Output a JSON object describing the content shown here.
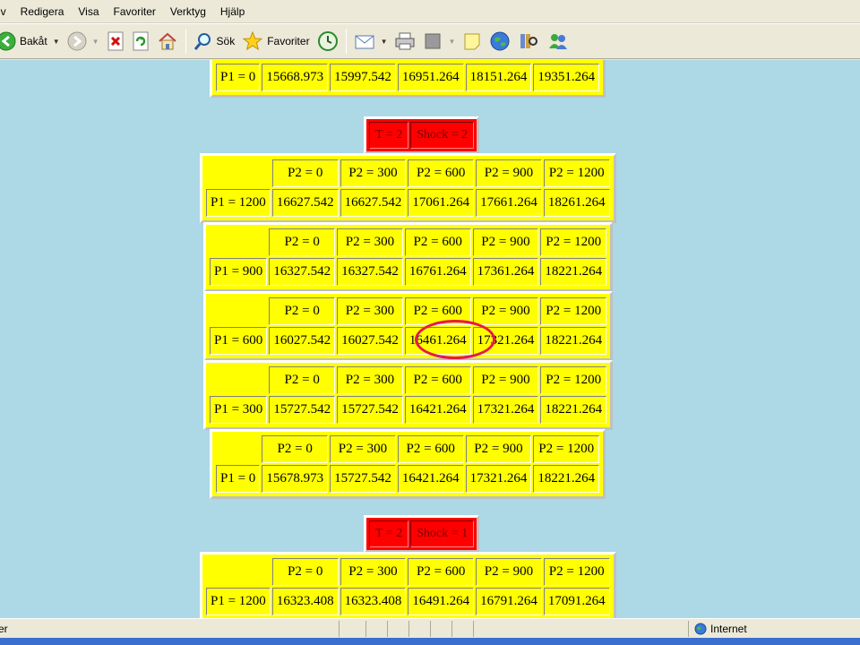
{
  "menu": [
    "iv",
    "Redigera",
    "Visa",
    "Favoriter",
    "Verktyg",
    "Hjälp"
  ],
  "toolbar": {
    "back_label": "Bakåt",
    "search_label": "Sök",
    "favorites_label": "Favoriter"
  },
  "tables": [
    {
      "rows": [
        [
          "P1 = 0",
          "15668.973",
          "15997.542",
          "16951.264",
          "18151.264",
          "19351.264"
        ]
      ]
    },
    {
      "rows": [
        [
          "",
          "P2 = 0",
          "P2 = 300",
          "P2 = 600",
          "P2 = 900",
          "P2 = 1200"
        ],
        [
          "P1 = 1200",
          "16627.542",
          "16627.542",
          "17061.264",
          "17661.264",
          "18261.264"
        ]
      ]
    },
    {
      "rows": [
        [
          "",
          "P2 = 0",
          "P2 = 300",
          "P2 = 600",
          "P2 = 900",
          "P2 = 1200"
        ],
        [
          "P1 = 900",
          "16327.542",
          "16327.542",
          "16761.264",
          "17361.264",
          "18221.264"
        ]
      ]
    },
    {
      "rows": [
        [
          "",
          "P2 = 0",
          "P2 = 300",
          "P2 = 600",
          "P2 = 900",
          "P2 = 1200"
        ],
        [
          "P1 = 600",
          "16027.542",
          "16027.542",
          "16461.264",
          "17321.264",
          "18221.264"
        ]
      ]
    },
    {
      "rows": [
        [
          "",
          "P2 = 0",
          "P2 = 300",
          "P2 = 600",
          "P2 = 900",
          "P2 = 1200"
        ],
        [
          "P1 = 300",
          "15727.542",
          "15727.542",
          "16421.264",
          "17321.264",
          "18221.264"
        ]
      ]
    },
    {
      "rows": [
        [
          "",
          "P2 = 0",
          "P2 = 300",
          "P2 = 600",
          "P2 = 900",
          "P2 = 1200"
        ],
        [
          "P1 = 0",
          "15678.973",
          "15727.542",
          "16421.264",
          "17321.264",
          "18221.264"
        ]
      ]
    },
    {
      "rows": [
        [
          "",
          "P2 = 0",
          "P2 = 300",
          "P2 = 600",
          "P2 = 900",
          "P2 = 1200"
        ],
        [
          "P1 = 1200",
          "16323.408",
          "16323.408",
          "16491.264",
          "16791.264",
          "17091.264"
        ]
      ]
    }
  ],
  "headers": [
    [
      "T = 2",
      "Shock = 2"
    ],
    [
      "T = 2",
      "Shock = 1"
    ]
  ],
  "status": {
    "left_text": "er",
    "zone_text": "Internet"
  },
  "colors": {
    "page_bg": "#add8e6",
    "cell_bg": "#ffff00",
    "header_bg": "#ff0000",
    "highlight": "#e6194b"
  }
}
